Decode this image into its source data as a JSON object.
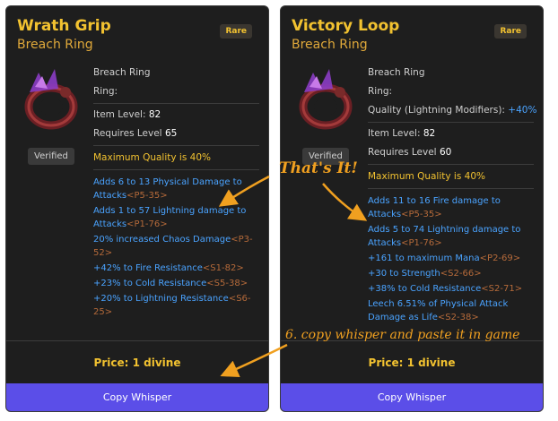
{
  "left": {
    "title": "Wrath Grip",
    "subtitle": "Breach Ring",
    "rarity": "Rare",
    "verified": "Verified",
    "base_type": "Breach Ring",
    "ring_label": "Ring:",
    "item_level_label": "Item Level:",
    "item_level": "82",
    "requires_label": "Requires Level",
    "requires_level": "65",
    "max_quality": "Maximum Quality is 40%",
    "mods": [
      {
        "text": "Adds 6 to 13 Physical Damage to Attacks",
        "tag": "<P5-35>"
      },
      {
        "text": "Adds 1 to 57 Lightning damage to Attacks",
        "tag": "<P1-76>"
      },
      {
        "text": "20% increased Chaos Damage",
        "tag": "<P3-52>"
      },
      {
        "text": "+42% to Fire Resistance",
        "tag": "<S1-82>"
      },
      {
        "text": "+23% to Cold Resistance",
        "tag": "<S5-38>"
      },
      {
        "text": "+20% to Lightning Resistance",
        "tag": "<S6-25>"
      }
    ],
    "price_label": "Price:",
    "price_value": "1 divine",
    "copy_button": "Copy Whisper"
  },
  "right": {
    "title": "Victory Loop",
    "subtitle": "Breach Ring",
    "rarity": "Rare",
    "verified": "Verified",
    "base_type": "Breach Ring",
    "ring_label": "Ring:",
    "quality_label": "Quality (Lightning Modifiers):",
    "quality_value": "+40%",
    "item_level_label": "Item Level:",
    "item_level": "82",
    "requires_label": "Requires Level",
    "requires_level": "60",
    "max_quality": "Maximum Quality is 40%",
    "mods": [
      {
        "text": "Adds 11 to 16 Fire damage to Attacks",
        "tag": "<P5-35>"
      },
      {
        "text": "Adds 5 to 74 Lightning damage to Attacks",
        "tag": "<P1-76>"
      },
      {
        "text": "+161 to maximum Mana",
        "tag": "<P2-69>"
      },
      {
        "text": "+30 to Strength",
        "tag": "<S2-66>"
      },
      {
        "text": "+38% to Cold Resistance",
        "tag": "<S2-71>"
      },
      {
        "text": "Leech 6.51% of Physical Attack Damage as Life",
        "tag": "<S2-38>"
      }
    ],
    "price_label": "Price:",
    "price_value": "1 divine",
    "copy_button": "Copy Whisper"
  },
  "annotations": {
    "thats_it": "That's It!",
    "step6": "6. copy whisper and paste it in game"
  },
  "colors": {
    "card_bg": "#1e1e1e",
    "gold": "#f2c230",
    "mod_blue": "#4aa3ff",
    "tag_brown": "#b56a3a",
    "button_purple": "#5b4ee8",
    "annotation_orange": "#f0a020"
  }
}
